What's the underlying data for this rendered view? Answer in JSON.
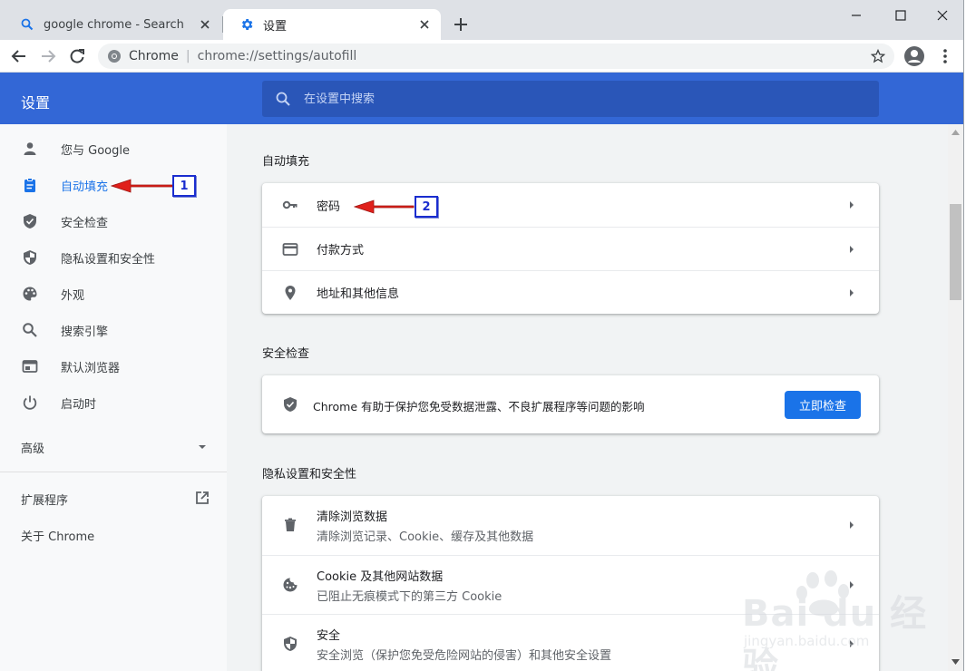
{
  "tabs": [
    {
      "title": "google chrome - Search",
      "active": false,
      "icon": "search-icon"
    },
    {
      "title": "设置",
      "active": true,
      "icon": "gear-icon"
    }
  ],
  "toolbar": {
    "site_name": "Chrome",
    "url": "chrome://settings/autofill"
  },
  "settings": {
    "title": "设置",
    "search_placeholder": "在设置中搜索"
  },
  "nav": {
    "items": [
      {
        "label": "您与 Google",
        "icon": "person-icon"
      },
      {
        "label": "自动填充",
        "icon": "clipboard-icon",
        "active": true
      },
      {
        "label": "安全检查",
        "icon": "shield-check-icon"
      },
      {
        "label": "隐私设置和安全性",
        "icon": "shield-half-icon"
      },
      {
        "label": "外观",
        "icon": "palette-icon"
      },
      {
        "label": "搜索引擎",
        "icon": "search-icon"
      },
      {
        "label": "默认浏览器",
        "icon": "browser-icon"
      },
      {
        "label": "启动时",
        "icon": "power-icon"
      }
    ],
    "advanced": "高级",
    "extensions": "扩展程序",
    "about": "关于 Chrome"
  },
  "autofill": {
    "title": "自动填充",
    "rows": [
      {
        "label": "密码",
        "icon": "key-icon"
      },
      {
        "label": "付款方式",
        "icon": "credit-card-icon"
      },
      {
        "label": "地址和其他信息",
        "icon": "location-pin-icon"
      }
    ]
  },
  "safety": {
    "title": "安全检查",
    "description": "Chrome 有助于保护您免受数据泄露、不良扩展程序等问题的影响",
    "button": "立即检查"
  },
  "privacy": {
    "title": "隐私设置和安全性",
    "rows": [
      {
        "label": "清除浏览数据",
        "sub": "清除浏览记录、Cookie、缓存及其他数据",
        "icon": "trash-icon"
      },
      {
        "label": "Cookie 及其他网站数据",
        "sub": "已阻止无痕模式下的第三方 Cookie",
        "icon": "cookie-icon"
      },
      {
        "label": "安全",
        "sub": "安全浏览（保护您免受危险网站的侵害）和其他安全设置",
        "icon": "security-shield-icon"
      }
    ]
  },
  "annotations": {
    "badge_1": "1",
    "badge_2": "2",
    "color": "#1a2dcf",
    "arrow_color": "#e0201b"
  },
  "watermark": {
    "main": "Bai du 经验",
    "sub": "jingyan.baidu.com"
  },
  "colors": {
    "header_blue": "#3367d6",
    "accent": "#1a73e8"
  }
}
